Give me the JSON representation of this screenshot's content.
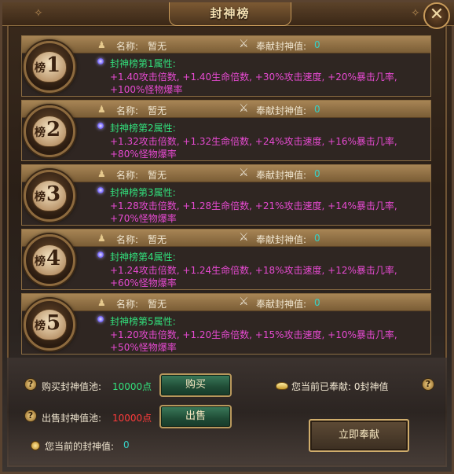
{
  "window": {
    "title": "封神榜",
    "close_glyph": "✕"
  },
  "rank_rows": [
    {
      "badge_char": "榜",
      "badge_num": "1",
      "name_label": "名称:",
      "name_value": "暂无",
      "contrib_label": "奉献封神值:",
      "contrib_value": "0",
      "attr_title": "封神榜第1属性:",
      "attr_text": "+1.40攻击倍数, +1.40生命倍数, +30%攻击速度, +20%暴击几率, +100%怪物爆率"
    },
    {
      "badge_char": "榜",
      "badge_num": "2",
      "name_label": "名称:",
      "name_value": "暂无",
      "contrib_label": "奉献封神值:",
      "contrib_value": "0",
      "attr_title": "封神榜第2属性:",
      "attr_text": "+1.32攻击倍数, +1.32生命倍数, +24%攻击速度, +16%暴击几率, +80%怪物爆率"
    },
    {
      "badge_char": "榜",
      "badge_num": "3",
      "name_label": "名称:",
      "name_value": "暂无",
      "contrib_label": "奉献封神值:",
      "contrib_value": "0",
      "attr_title": "封神榜第3属性:",
      "attr_text": "+1.28攻击倍数, +1.28生命倍数, +21%攻击速度, +14%暴击几率, +70%怪物爆率"
    },
    {
      "badge_char": "榜",
      "badge_num": "4",
      "name_label": "名称:",
      "name_value": "暂无",
      "contrib_label": "奉献封神值:",
      "contrib_value": "0",
      "attr_title": "封神榜第4属性:",
      "attr_text": "+1.24攻击倍数, +1.24生命倍数, +18%攻击速度, +12%暴击几率, +60%怪物爆率"
    },
    {
      "badge_char": "榜",
      "badge_num": "5",
      "name_label": "名称:",
      "name_value": "暂无",
      "contrib_label": "奉献封神值:",
      "contrib_value": "0",
      "attr_title": "封神榜第5属性:",
      "attr_text": "+1.20攻击倍数, +1.20生命倍数, +15%攻击速度, +10%暴击几率, +50%怪物爆率"
    }
  ],
  "bottom": {
    "buy_pool_label": "购买封神值池:",
    "buy_pool_value": "10000点",
    "buy_button": "购买",
    "sell_pool_label": "出售封神值池:",
    "sell_pool_value": "10000点",
    "sell_button": "出售",
    "current_contributed": "您当前已奉献: 0封神值",
    "current_value_label": "您当前的封神值:",
    "current_value": "0",
    "contribute_button": "立即奉献",
    "help_glyph": "?"
  },
  "icons": {
    "person": "person-icon",
    "crossed_swords": "crossed-swords-icon",
    "star": "purple-star-icon",
    "gold": "gold-ingot-icon",
    "coin": "coin-icon",
    "help": "help-icon"
  },
  "colors": {
    "green": "#32e07c",
    "magenta": "#e64ad1",
    "cyan": "#36d1c6",
    "red": "#ff3b3b"
  }
}
